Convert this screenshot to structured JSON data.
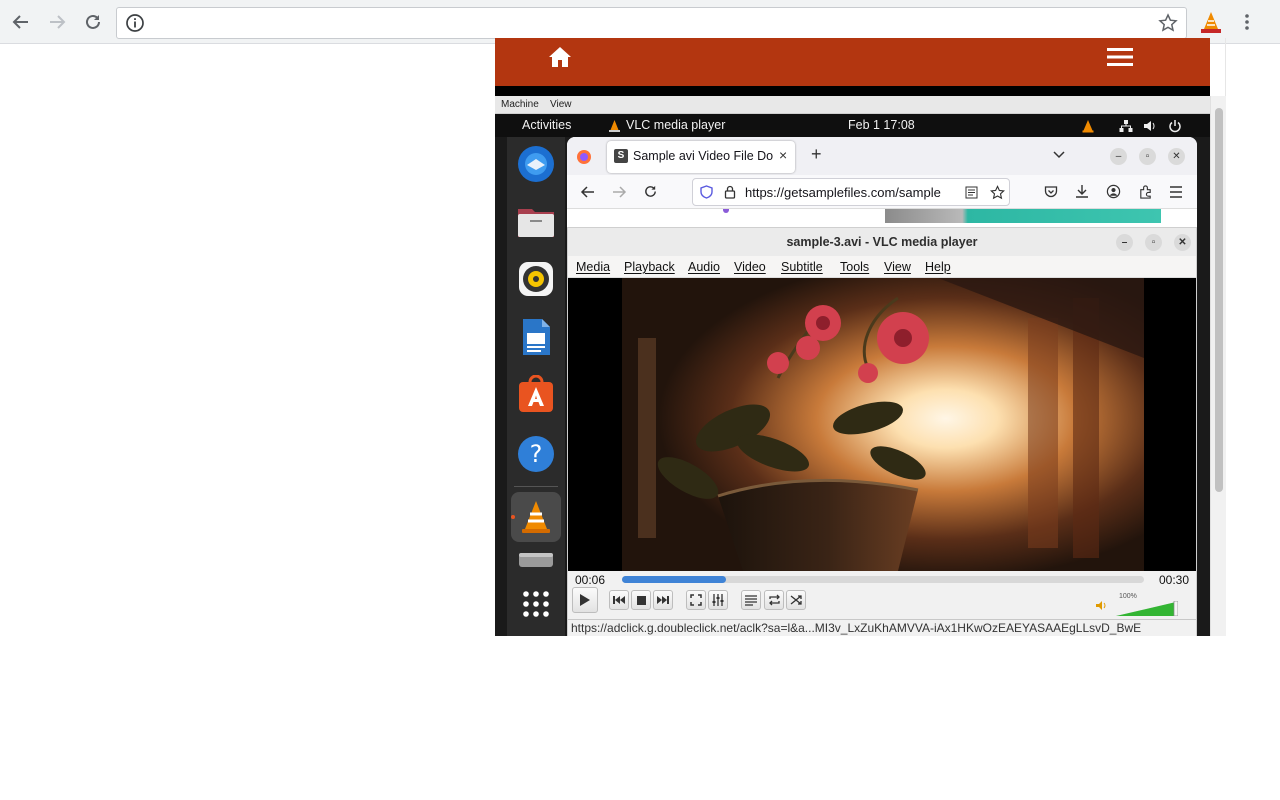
{
  "browser": {
    "url": "",
    "back_icon": "arrow-left-icon",
    "forward_icon": "arrow-right-icon",
    "reload_icon": "reload-icon",
    "info_icon": "info-icon",
    "star_icon": "star-icon",
    "extension_icon": "vlc-cone-icon",
    "menu_icon": "kebab-menu-icon"
  },
  "site": {
    "header_color": "#b33610",
    "home_icon": "home-icon",
    "menu_icon": "hamburger-icon"
  },
  "vm_menu": {
    "items": [
      "Machine",
      "View"
    ]
  },
  "ubuntu": {
    "activities": "Activities",
    "app_name": "VLC media player",
    "clock": "Feb 1  17:08",
    "dock": [
      "thunderbird-icon",
      "files-icon",
      "rhythmbox-icon",
      "writer-icon",
      "app-center-icon",
      "help-icon",
      "vlc-icon",
      "drive-icon",
      "apps-grid-icon"
    ]
  },
  "firefox": {
    "tab_title": "Sample avi Video File Do",
    "url": "https://getsamplefiles.com/sample"
  },
  "vlc": {
    "title": "sample-3.avi - VLC media player",
    "menu": [
      "Media",
      "Playback",
      "Audio",
      "Video",
      "Subtitle",
      "Tools",
      "View",
      "Help"
    ],
    "elapsed": "00:06",
    "total": "00:30",
    "progress": 0.2,
    "volume_label": "100%",
    "volume": 1.0,
    "status_url": "https://adclick.g.doubleclick.net/aclk?sa=l&a...MI3v_LxZuKhAMVVA-iAx1HKwOzEAEYASAAEgLLsvD_BwE"
  }
}
